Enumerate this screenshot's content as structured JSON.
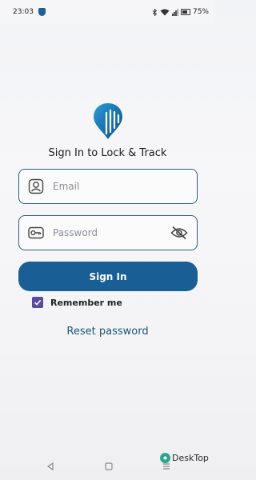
{
  "status_bar": {
    "time": "23:03",
    "icons": [
      "shield-app-icon",
      "bluetooth-icon",
      "wifi-icon",
      "signal-icon",
      "battery-icon"
    ],
    "battery_percent": "75%"
  },
  "app": {
    "title": "Sign In to Lock & Track",
    "accent_color": "#1a5e96",
    "border_color": "#2a5d86"
  },
  "form": {
    "email_placeholder": "Email",
    "password_placeholder": "Password",
    "sign_in_label": "Sign In",
    "remember_label": "Remember me",
    "remember_checked": true,
    "reset_label": "Reset password"
  },
  "nav_bar": {
    "buttons": [
      "back-icon",
      "home-icon",
      "recents-icon"
    ]
  },
  "watermark": {
    "text": "DeskTop"
  }
}
